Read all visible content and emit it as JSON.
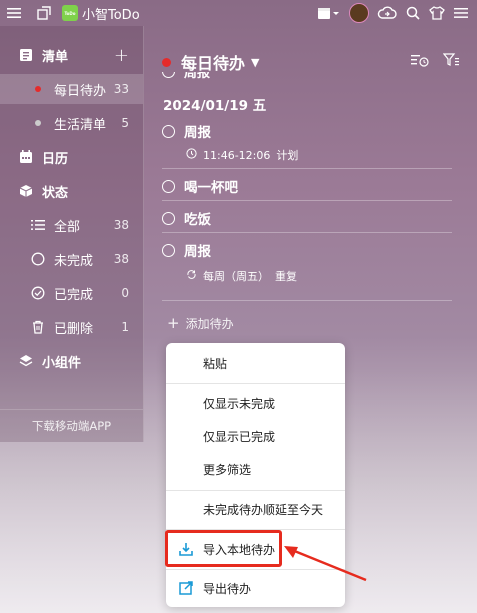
{
  "app": {
    "name": "小智ToDo",
    "logo_text": "ToDo"
  },
  "colors": {
    "accent_red": "#e52b2b",
    "highlight": "#e62b1e",
    "menu_icon_blue": "#1a9ad6"
  },
  "titlebar": {
    "icons": [
      "hamburger-icon",
      "popout-icon",
      "calendar-icon",
      "avatar",
      "cloud-sync-icon",
      "search-icon",
      "shirt-icon",
      "menu-icon"
    ]
  },
  "sidebar": {
    "list_header": "清单",
    "lists": [
      {
        "label": "每日待办",
        "count": "33"
      },
      {
        "label": "生活清单",
        "count": "5"
      }
    ],
    "calendar": "日历",
    "status_header": "状态",
    "status": [
      {
        "label": "全部",
        "count": "38"
      },
      {
        "label": "未完成",
        "count": "38"
      },
      {
        "label": "已完成",
        "count": "0"
      },
      {
        "label": "已删除",
        "count": "1"
      }
    ],
    "widgets": "小组件",
    "download": "下载移动端APP"
  },
  "main": {
    "title": "每日待办",
    "cut_task": "周报",
    "date_heading": "2024/01/19 五",
    "tasks": [
      {
        "title": "周报",
        "meta_time": "11:46-12:06",
        "meta_tag": "计划"
      },
      {
        "title": "喝一杯吧"
      },
      {
        "title": "吃饭"
      },
      {
        "title": "周报",
        "meta_repeat": "每周（周五）",
        "meta_tag": "重复"
      }
    ],
    "add_task": "添加待办"
  },
  "context_menu": {
    "items": [
      "粘贴",
      "仅显示未完成",
      "仅显示已完成",
      "更多筛选",
      "未完成待办顺延至今天",
      "导入本地待办",
      "导出待办"
    ]
  }
}
